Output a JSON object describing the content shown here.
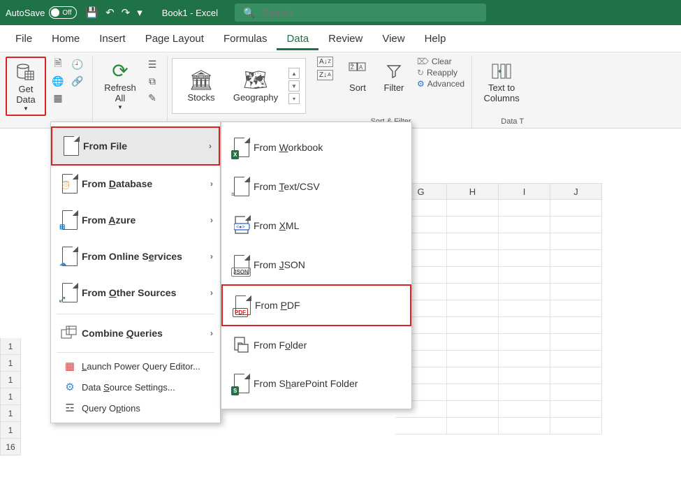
{
  "titlebar": {
    "autosave_label": "AutoSave",
    "autosave_state": "Off",
    "doc_name": "Book1 - Excel",
    "search_placeholder": "Search"
  },
  "tabs": {
    "file": "File",
    "home": "Home",
    "insert": "Insert",
    "page_layout": "Page Layout",
    "formulas": "Formulas",
    "data": "Data",
    "review": "Review",
    "view": "View",
    "help": "Help"
  },
  "ribbon": {
    "get_data": "Get\nData",
    "refresh_all": "Refresh\nAll",
    "stocks": "Stocks",
    "geography": "Geography",
    "sort": "Sort",
    "filter": "Filter",
    "clear": "Clear",
    "reapply": "Reapply",
    "advanced": "Advanced",
    "sort_filter_group": "Sort & Filter",
    "text_to_columns": "Text to\nColumns",
    "data_tools_group": "Data T"
  },
  "menu1": {
    "from_file": "From File",
    "from_database": "From Database",
    "from_azure": "From Azure",
    "from_online_services": "From Online Services",
    "from_other_sources": "From Other Sources",
    "combine_queries": "Combine Queries",
    "launch_pq": "Launch Power Query Editor...",
    "data_source_settings": "Data Source Settings...",
    "query_options": "Query Options"
  },
  "menu2": {
    "from_workbook": "From Workbook",
    "from_text_csv": "From Text/CSV",
    "from_xml": "From XML",
    "from_json": "From JSON",
    "from_pdf": "From PDF",
    "from_folder": "From Folder",
    "from_sharepoint": "From SharePoint Folder"
  },
  "grid": {
    "columns": [
      "G",
      "H",
      "I",
      "J"
    ],
    "rownums": [
      "1",
      "1",
      "1",
      "1",
      "1",
      "1",
      "16"
    ]
  }
}
